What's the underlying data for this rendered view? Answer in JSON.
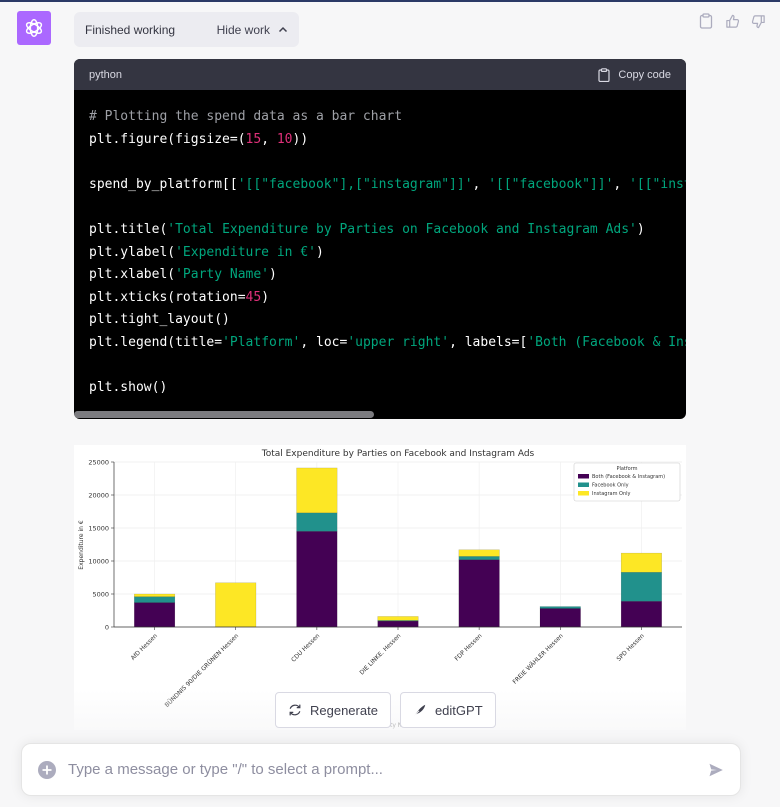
{
  "status": {
    "label": "Finished working",
    "toggle_label": "Hide work"
  },
  "code": {
    "language": "python",
    "copy_label": "Copy code",
    "lines": {
      "l1": "# Plotting the spend data as a bar chart",
      "l2a": "plt.figure(figsize=(",
      "l2b": "15",
      "l2c": ", ",
      "l2d": "10",
      "l2e": "))",
      "l3a": "spend_by_platform[[",
      "l3b": "'[[\"facebook\"],[\"instagram\"]]'",
      "l3c": ", ",
      "l3d": "'[[\"facebook\"]]'",
      "l3e": ", ",
      "l3f": "'[[\"instagram\"]]'",
      "l4a": "plt.title(",
      "l4b": "'Total Expenditure by Parties on Facebook and Instagram Ads'",
      "l4c": ")",
      "l5a": "plt.ylabel(",
      "l5b": "'Expenditure in €'",
      "l5c": ")",
      "l6a": "plt.xlabel(",
      "l6b": "'Party Name'",
      "l6c": ")",
      "l7a": "plt.xticks(rotation=",
      "l7b": "45",
      "l7c": ")",
      "l8": "plt.tight_layout()",
      "l9a": "plt.legend(title=",
      "l9b": "'Platform'",
      "l9c": ", loc=",
      "l9d": "'upper right'",
      "l9e": ", labels=[",
      "l9f": "'Both (Facebook & Instagram)'",
      "l10": "plt.show()"
    }
  },
  "chart_data": {
    "type": "bar",
    "stacked": true,
    "title": "Total Expenditure by Parties on Facebook and Instagram Ads",
    "ylabel": "Expenditure in €",
    "xlabel": "Party Name",
    "ylim": [
      0,
      25000
    ],
    "yticks": [
      0,
      5000,
      10000,
      15000,
      20000,
      25000
    ],
    "categories": [
      "AfD Hessen",
      "BÜNDNIS 90/DIE GRÜNEN Hessen",
      "CDU Hessen",
      "DIE LINKE. Hessen",
      "FDP Hessen",
      "FREIE WÄHLER Hessen",
      "SPD Hessen"
    ],
    "series": [
      {
        "name": "Both (Facebook & Instagram)",
        "color": "#440154",
        "values": [
          3700,
          0,
          14500,
          900,
          10200,
          2800,
          3900
        ]
      },
      {
        "name": "Facebook Only",
        "color": "#21918c",
        "values": [
          900,
          0,
          2800,
          100,
          500,
          300,
          4400
        ]
      },
      {
        "name": "Instagram Only",
        "color": "#fde725",
        "values": [
          400,
          6700,
          6800,
          600,
          1000,
          0,
          2900
        ]
      }
    ],
    "legend_title": "Platform",
    "legend_position": "top-right",
    "grid": true
  },
  "buttons": {
    "regenerate": "Regenerate",
    "edit": "editGPT"
  },
  "composer": {
    "placeholder": "Type a message or type \"/\" to select a prompt..."
  }
}
